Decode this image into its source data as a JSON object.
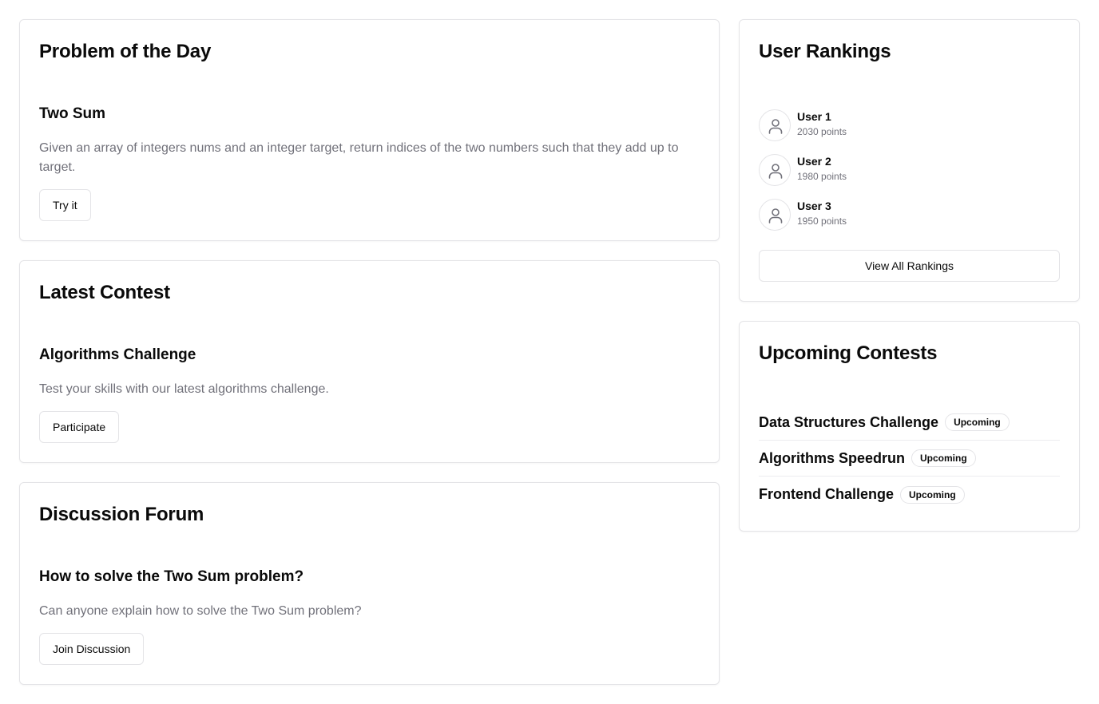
{
  "problem_of_day": {
    "heading": "Problem of the Day",
    "title": "Two Sum",
    "description": "Given an array of integers nums and an integer target, return indices of the two numbers such that they add up to target.",
    "button_label": "Try it"
  },
  "latest_contest": {
    "heading": "Latest Contest",
    "title": "Algorithms Challenge",
    "description": "Test your skills with our latest algorithms challenge.",
    "button_label": "Participate"
  },
  "discussion_forum": {
    "heading": "Discussion Forum",
    "title": "How to solve the Two Sum problem?",
    "description": "Can anyone explain how to solve the Two Sum problem?",
    "button_label": "Join Discussion"
  },
  "user_rankings": {
    "heading": "User Rankings",
    "users": [
      {
        "name": "User 1",
        "points": "2030 points",
        "icon": "user-icon"
      },
      {
        "name": "User 2",
        "points": "1980 points",
        "icon": "user-icon"
      },
      {
        "name": "User 3",
        "points": "1950 points",
        "icon": "user-icon"
      }
    ],
    "button_label": "View All Rankings"
  },
  "upcoming_contests": {
    "heading": "Upcoming Contests",
    "contests": [
      {
        "name": "Data Structures Challenge",
        "status": "Upcoming"
      },
      {
        "name": "Algorithms Speedrun",
        "status": "Upcoming"
      },
      {
        "name": "Frontend Challenge",
        "status": "Upcoming"
      }
    ]
  },
  "colors": {
    "border": "#e4e4e7",
    "muted_text": "#71717a",
    "text": "#0a0a0a",
    "background": "#ffffff"
  }
}
